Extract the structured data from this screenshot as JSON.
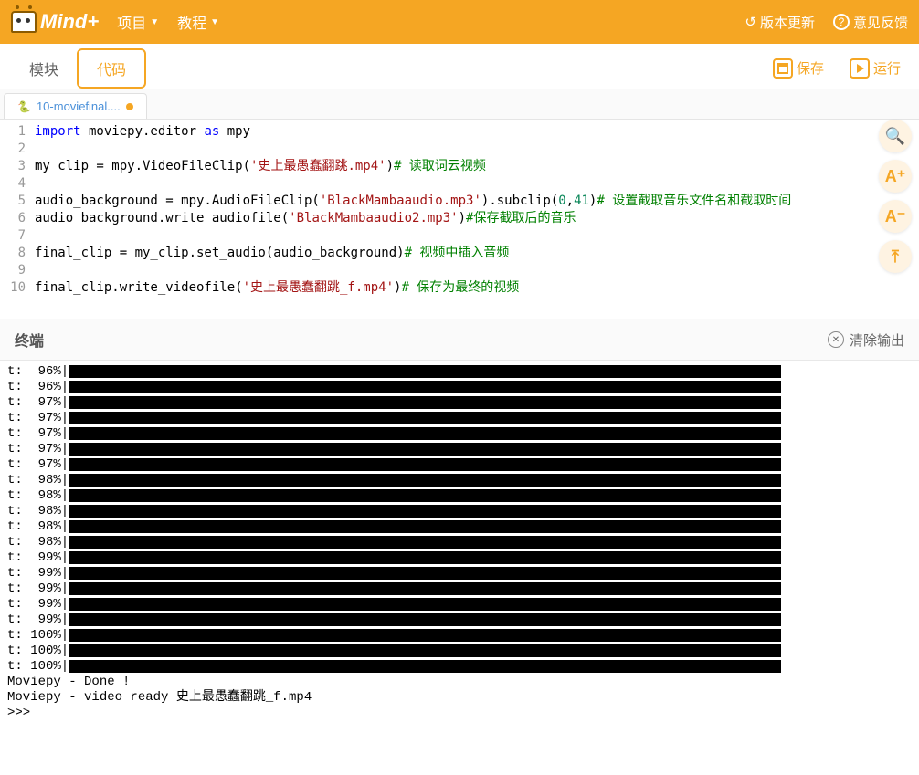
{
  "header": {
    "logo_text": "Mind+",
    "menu_project": "项目",
    "menu_tutorial": "教程",
    "version_update": "版本更新",
    "feedback": "意见反馈"
  },
  "toolbar": {
    "tab_blocks": "模块",
    "tab_code": "代码",
    "save": "保存",
    "run": "运行"
  },
  "file_tab": {
    "name": "10-moviefinal....",
    "dirty": true
  },
  "code": {
    "lines": [
      {
        "n": 1,
        "segments": [
          {
            "t": "kw",
            "v": "import"
          },
          {
            "t": "",
            "v": " moviepy.editor "
          },
          {
            "t": "kw",
            "v": "as"
          },
          {
            "t": "",
            "v": " mpy"
          }
        ]
      },
      {
        "n": 2,
        "segments": []
      },
      {
        "n": 3,
        "segments": [
          {
            "t": "",
            "v": "my_clip = mpy.VideoFileClip("
          },
          {
            "t": "str",
            "v": "'史上最愚蠢翻跳.mp4'"
          },
          {
            "t": "",
            "v": ")"
          },
          {
            "t": "cmt",
            "v": "# 读取词云视频"
          }
        ]
      },
      {
        "n": 4,
        "segments": []
      },
      {
        "n": 5,
        "segments": [
          {
            "t": "",
            "v": "audio_background = mpy.AudioFileClip("
          },
          {
            "t": "str",
            "v": "'BlackMambaaudio.mp3'"
          },
          {
            "t": "",
            "v": ").subclip("
          },
          {
            "t": "num",
            "v": "0"
          },
          {
            "t": "",
            "v": ","
          },
          {
            "t": "num",
            "v": "41"
          },
          {
            "t": "",
            "v": ")"
          },
          {
            "t": "cmt",
            "v": "# 设置截取音乐文件名和截取时间"
          }
        ]
      },
      {
        "n": 6,
        "segments": [
          {
            "t": "",
            "v": "audio_background.write_audiofile("
          },
          {
            "t": "str",
            "v": "'BlackMambaaudio2.mp3'"
          },
          {
            "t": "",
            "v": ")"
          },
          {
            "t": "cmt",
            "v": "#保存截取后的音乐"
          }
        ]
      },
      {
        "n": 7,
        "segments": []
      },
      {
        "n": 8,
        "segments": [
          {
            "t": "",
            "v": "final_clip = my_clip.set_audio(audio_background)"
          },
          {
            "t": "cmt",
            "v": "# 视频中插入音频"
          }
        ]
      },
      {
        "n": 9,
        "segments": []
      },
      {
        "n": 10,
        "segments": [
          {
            "t": "",
            "v": "final_clip.write_videofile("
          },
          {
            "t": "str",
            "v": "'史上最愚蠢翻跳_f.mp4'"
          },
          {
            "t": "",
            "v": ")"
          },
          {
            "t": "cmt",
            "v": "# 保存为最终的视频"
          }
        ]
      }
    ]
  },
  "side_tools": {
    "search": "🔍",
    "font_plus": "A⁺",
    "font_minus": "A⁻",
    "collapse": "⤒"
  },
  "terminal": {
    "title": "终端",
    "clear": "清除输出",
    "progress_lines": [
      {
        "pct": "96%",
        "bar": 780
      },
      {
        "pct": "96%",
        "bar": 780
      },
      {
        "pct": "97%",
        "bar": 780
      },
      {
        "pct": "97%",
        "bar": 780
      },
      {
        "pct": "97%",
        "bar": 780
      },
      {
        "pct": "97%",
        "bar": 780
      },
      {
        "pct": "97%",
        "bar": 780
      },
      {
        "pct": "98%",
        "bar": 780
      },
      {
        "pct": "98%",
        "bar": 780
      },
      {
        "pct": "98%",
        "bar": 780
      },
      {
        "pct": "98%",
        "bar": 780
      },
      {
        "pct": "98%",
        "bar": 780
      },
      {
        "pct": "99%",
        "bar": 780
      },
      {
        "pct": "99%",
        "bar": 780
      },
      {
        "pct": "99%",
        "bar": 780
      },
      {
        "pct": "99%",
        "bar": 780
      },
      {
        "pct": "99%",
        "bar": 780
      },
      {
        "pct": "100%",
        "bar": 780
      },
      {
        "pct": "100%",
        "bar": 780
      },
      {
        "pct": "100%",
        "bar": 780
      }
    ],
    "footer_lines": [
      "Moviepy - Done !",
      "Moviepy - video ready 史上最愚蠢翻跳_f.mp4",
      ">>> "
    ]
  }
}
